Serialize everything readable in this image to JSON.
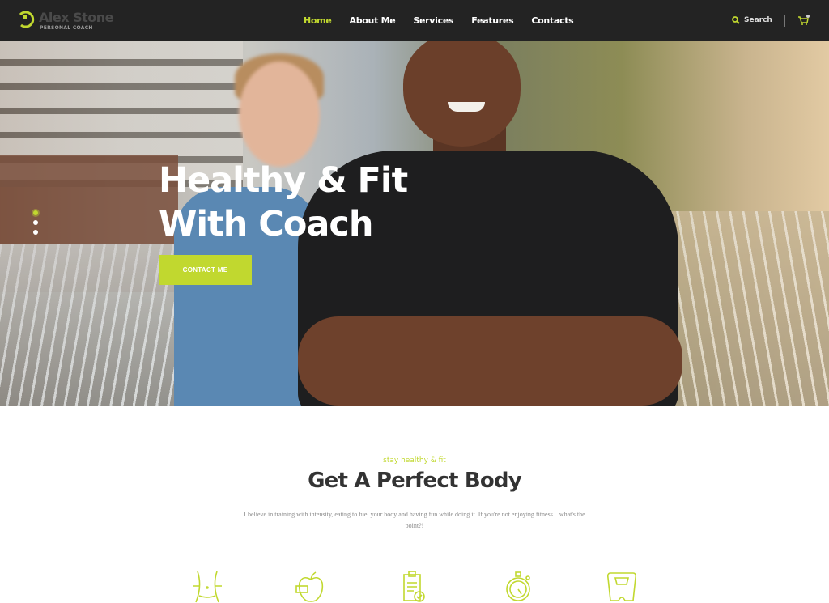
{
  "header": {
    "brand": "Alex Stone",
    "tagline": "PERSONAL COACH",
    "nav": [
      {
        "label": "Home",
        "active": true
      },
      {
        "label": "About Me"
      },
      {
        "label": "Services"
      },
      {
        "label": "Features"
      },
      {
        "label": "Contacts"
      }
    ],
    "search_label": "Search",
    "cart_icon": "cart-icon",
    "search_icon": "search-icon"
  },
  "hero": {
    "title_line1": "Healthy & Fit",
    "title_line2": "With Coach",
    "cta": "CONTACT ME",
    "slides": 3,
    "active_slide": 1
  },
  "intro": {
    "tag": "stay healthy & fit",
    "title": "Get A Perfect Body",
    "text": "I believe in training with intensity, eating to fuel your body and having fun while doing it. If you're not enjoying fitness... what's the point?!"
  },
  "features": [
    "waist-icon",
    "apple-measure-icon",
    "clipboard-check-icon",
    "stopwatch-icon",
    "scale-icon"
  ],
  "colors": {
    "accent": "#c1d82f",
    "header_bg": "#232323"
  }
}
